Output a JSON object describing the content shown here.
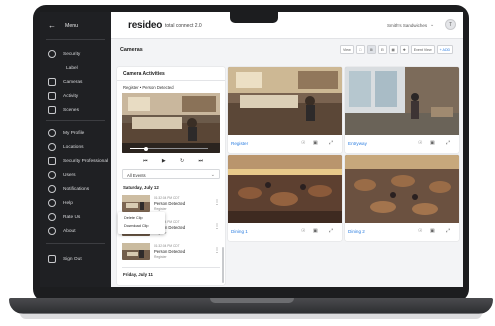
{
  "sidebar": {
    "menu_label": "Menu",
    "items": [
      {
        "label": "Security",
        "icon": "shield-icon"
      },
      {
        "label": "Label",
        "icon": "",
        "sub": true
      },
      {
        "label": "Cameras",
        "icon": "camera-icon"
      },
      {
        "label": "Activity",
        "icon": "activity-icon"
      },
      {
        "label": "Scenes",
        "icon": "scenes-icon"
      },
      {
        "label": "My Profile",
        "icon": "profile-icon"
      },
      {
        "label": "Locations",
        "icon": "location-icon"
      },
      {
        "label": "Security Professional",
        "icon": "professional-icon"
      },
      {
        "label": "Users",
        "icon": "users-icon"
      },
      {
        "label": "Notifications",
        "icon": "bell-icon"
      },
      {
        "label": "Help",
        "icon": "help-icon"
      },
      {
        "label": "Rate Us",
        "icon": "star-icon"
      },
      {
        "label": "About",
        "icon": "info-icon"
      },
      {
        "label": "Sign Out",
        "icon": "sign-out-icon"
      }
    ]
  },
  "header": {
    "logo": "resideo",
    "product": "total connect 2.0",
    "account": "Smith's Sandwiches",
    "avatar_initial": "T"
  },
  "page": {
    "title": "Cameras",
    "toolbar": {
      "view_label": "View",
      "event_view_label": "Event View",
      "add_label": "+ ADD"
    }
  },
  "activity": {
    "title": "Camera Activities",
    "clip_title": "Register • Person Detected",
    "playback_progress": 0.2,
    "filter_value": "All Events",
    "days": [
      "Saturday, July 12",
      "Friday, July 11"
    ],
    "events": [
      {
        "time": "01:32:04 PM CDT",
        "title": "Person Detected",
        "camera": "Register"
      },
      {
        "time": "01:32:04 PM CDT",
        "title": "Person Detected",
        "camera": "Register"
      },
      {
        "time": "01:32:04 PM CDT",
        "title": "Person Detected",
        "camera": "Register"
      }
    ],
    "context_menu": [
      "Delete Clip",
      "Download Clip"
    ]
  },
  "cameras": [
    {
      "name": "Register"
    },
    {
      "name": "Entryway"
    },
    {
      "name": "Dining 1"
    },
    {
      "name": "Dining 2"
    }
  ],
  "colors": {
    "accent": "#2b7de0",
    "sidebar_bg": "#1f2023",
    "frame": "#1c1d1f"
  }
}
